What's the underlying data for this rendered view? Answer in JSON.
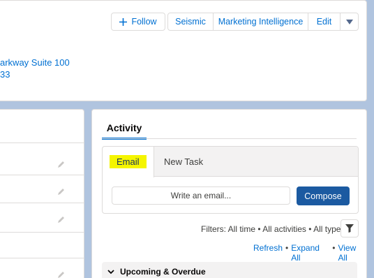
{
  "header": {
    "actions": {
      "follow": "Follow",
      "group": [
        "Seismic",
        "Marketing Intelligence",
        "Edit"
      ]
    },
    "address": [
      "arkway Suite 100",
      "33"
    ]
  },
  "activity": {
    "tab": "Activity",
    "composer": {
      "email_tab": "Email",
      "new_task_tab": "New Task",
      "email_placeholder": "Write an email...",
      "compose": "Compose"
    },
    "filters": "Filters: All time • All activities • All types",
    "links": {
      "refresh": "Refresh",
      "expand_all": "Expand All",
      "view_all": "View All",
      "separator": "•"
    },
    "section": "Upcoming & Overdue"
  },
  "colors": {
    "brand": "#0070d2",
    "highlight": "#f5f500",
    "compose": "#1b5aa1",
    "background": "#b0c4df"
  }
}
